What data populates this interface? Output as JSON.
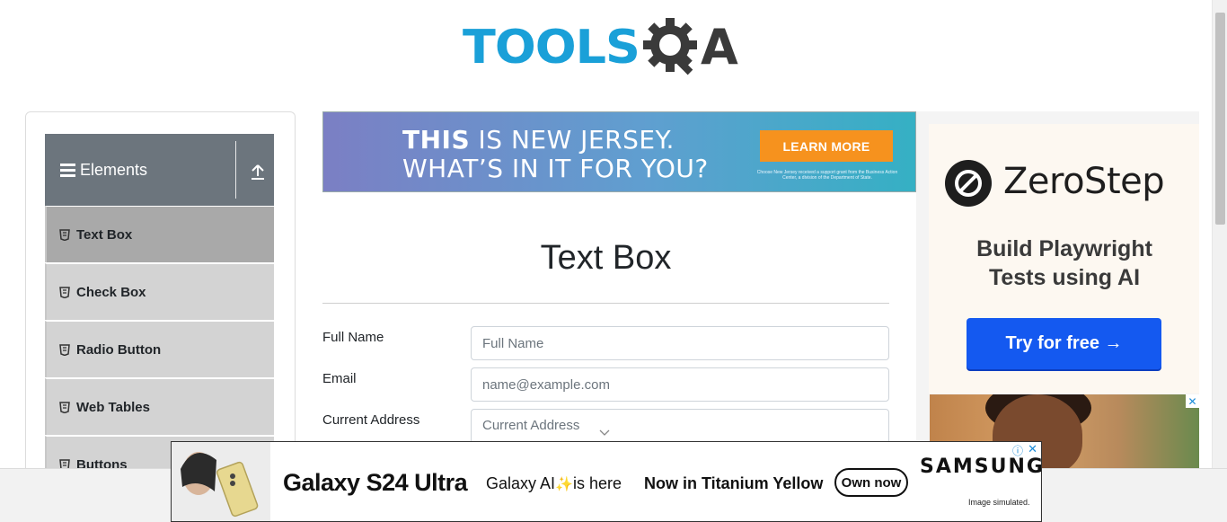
{
  "header": {
    "logo_text_left": "TOOLS",
    "logo_text_right": "A",
    "logo_colors": {
      "tools": "#1aa0d8",
      "qa": "#3a3a3a"
    }
  },
  "sidebar": {
    "group_title": "Elements",
    "items": [
      {
        "label": "Text Box",
        "active": true
      },
      {
        "label": "Check Box",
        "active": false
      },
      {
        "label": "Radio Button",
        "active": false
      },
      {
        "label": "Web Tables",
        "active": false
      },
      {
        "label": "Buttons",
        "active": false
      }
    ]
  },
  "top_ad": {
    "line1_bold": "THIS",
    "line1_rest": " IS NEW JERSEY.",
    "line2": "WHAT’S IN IT FOR YOU?",
    "cta": "LEARN MORE",
    "fine_print": "Choose New Jersey received a support grant from the Business Action Center, a division of the Department of State."
  },
  "main": {
    "title": "Text Box",
    "fields": {
      "full_name": {
        "label": "Full Name",
        "placeholder": "Full Name",
        "value": ""
      },
      "email": {
        "label": "Email",
        "placeholder": "name@example.com",
        "value": ""
      },
      "current_address": {
        "label": "Current Address",
        "placeholder": "Current Address",
        "value": ""
      }
    }
  },
  "right_ad": {
    "brand": "ZeroStep",
    "tagline_line1": "Build Playwright",
    "tagline_line2": "Tests using AI",
    "cta": "Try for free →",
    "cta_color": "#1459f0",
    "close_symbol": "✕"
  },
  "bottom_ad": {
    "product": "Galaxy S24 Ultra",
    "galaxy_ai_pre": "Galaxy AI",
    "galaxy_ai_post": "is here",
    "sparkle": "✨",
    "color_line": "Now in Titanium Yellow",
    "cta": "Own now",
    "brand": "SAMSUNG",
    "disclaimer": "Image simulated.",
    "info_symbol": "ⓘ",
    "close_symbol": "✕"
  }
}
